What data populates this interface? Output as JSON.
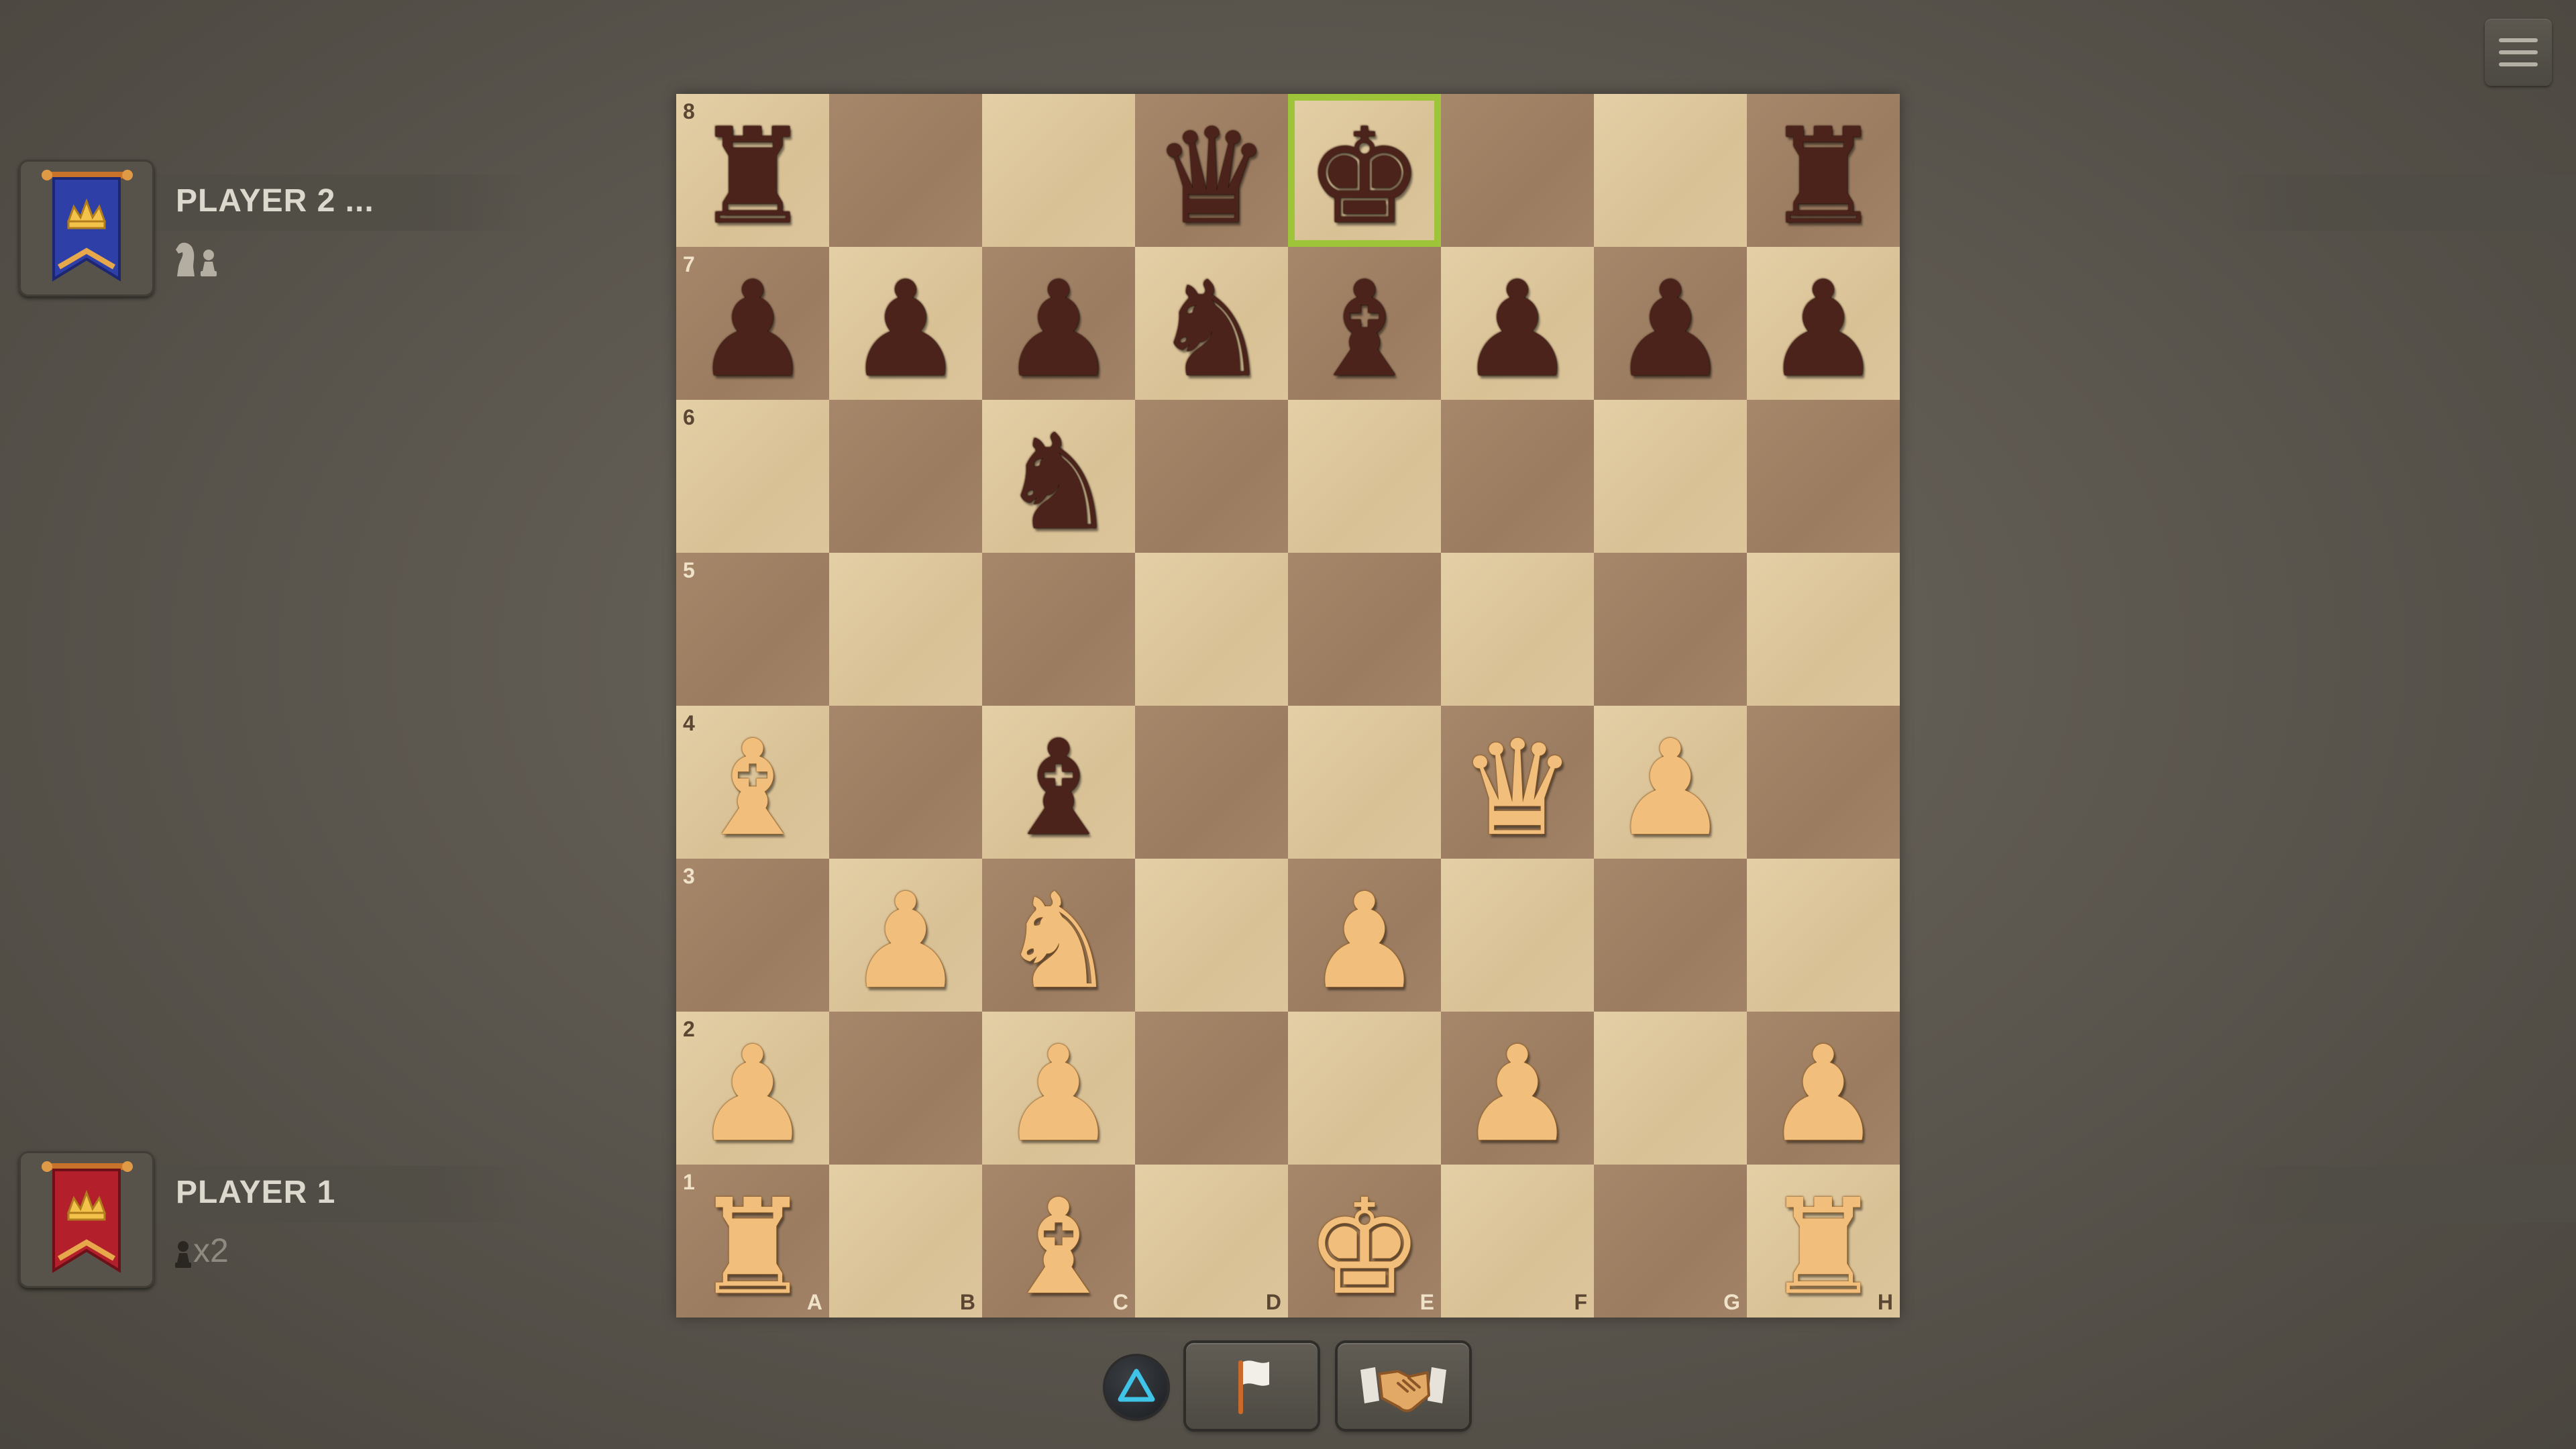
{
  "menu": {
    "icon": "hamburger-menu-icon"
  },
  "players": {
    "top": {
      "name": "PLAYER 2 ...",
      "banner_color": "#2f3fa8",
      "captured": [
        "knight",
        "pawn"
      ],
      "captured_count": ""
    },
    "bottom": {
      "name": "PLAYER 1",
      "banner_color": "#b3202c",
      "captured": [
        "pawn"
      ],
      "captured_count": "x2"
    }
  },
  "board": {
    "highlight_square": "e8",
    "highlight_color": "#9ec43a",
    "rank_labels": [
      "8",
      "7",
      "6",
      "5",
      "4",
      "3",
      "2",
      "1"
    ],
    "file_labels": [
      "A",
      "B",
      "C",
      "D",
      "E",
      "F",
      "G",
      "H"
    ],
    "rows": [
      [
        "br",
        "",
        "",
        "bq",
        "bk",
        "",
        "",
        "br"
      ],
      [
        "bp",
        "bp",
        "bp",
        "bn",
        "bb",
        "bp",
        "bp",
        "bp"
      ],
      [
        "",
        "",
        "bn",
        "",
        "",
        "",
        "",
        ""
      ],
      [
        "",
        "",
        "",
        "",
        "",
        "",
        "",
        ""
      ],
      [
        "wb",
        "",
        "bb",
        "",
        "",
        "wq",
        "wp",
        ""
      ],
      [
        "",
        "wp",
        "wn",
        "",
        "wp",
        "",
        "",
        ""
      ],
      [
        "wp",
        "",
        "wp",
        "",
        "",
        "wp",
        "",
        "wp"
      ],
      [
        "wr",
        "",
        "wb",
        "",
        "wk",
        "",
        "",
        "wr"
      ]
    ]
  },
  "controls": {
    "triangle_button": "triangle-icon",
    "resign_button": "flag-icon",
    "draw_button": "handshake-icon"
  }
}
